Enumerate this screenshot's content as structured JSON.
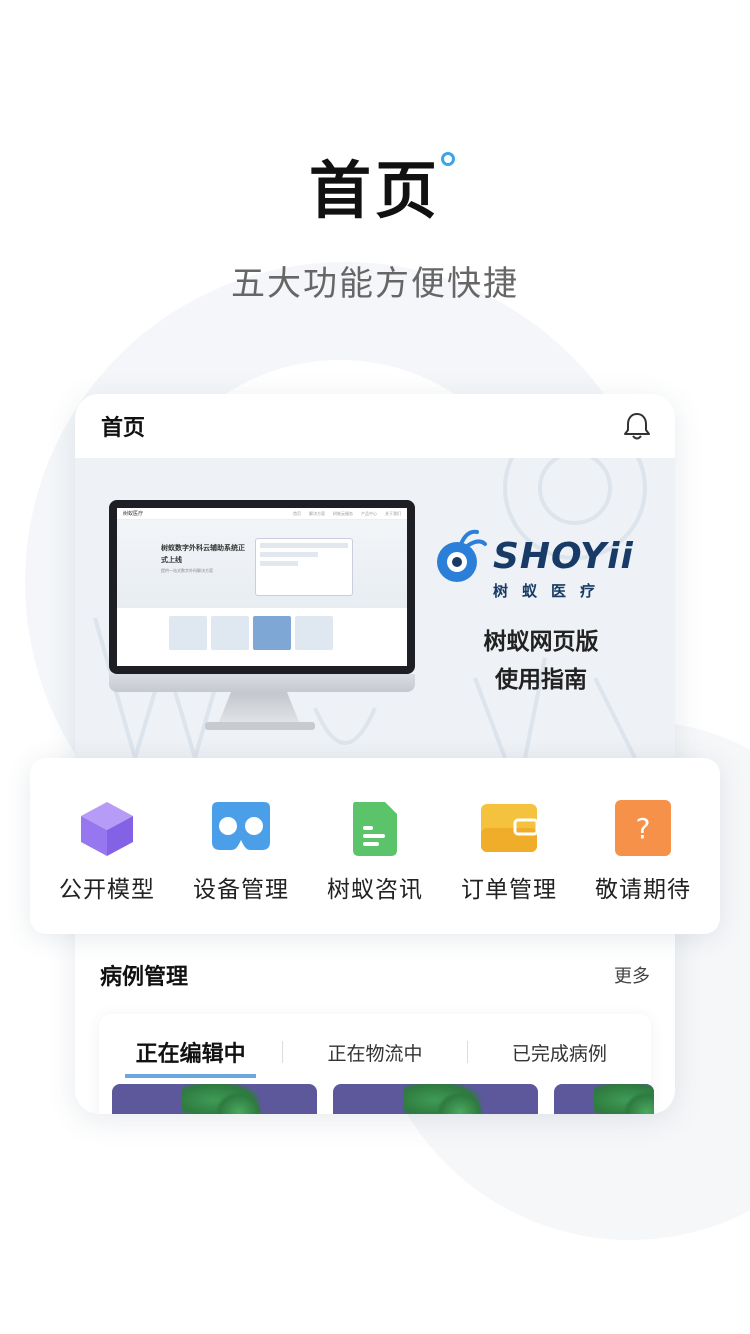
{
  "hero": {
    "title": "首页",
    "subtitle": "五大功能方便快捷"
  },
  "phone": {
    "header_title": "首页",
    "bell_icon": "bell-icon",
    "banner": {
      "screen_logo": "树蚁医疗",
      "screen_nav": [
        "首页",
        "解决方案",
        "树蚁云服务",
        "产品中心",
        "关于我们"
      ],
      "screen_title": "树蚁数字外科云辅助系统正式上线",
      "screen_sub": "提供一站式数字外科解决方案",
      "brand_word": "SHOYii",
      "brand_cn": "树蚁医疗",
      "tag_line1": "树蚁网页版",
      "tag_line2": "使用指南"
    }
  },
  "functions": [
    {
      "label": "公开模型",
      "icon": "cube-icon",
      "color": "#9b7cf2"
    },
    {
      "label": "设备管理",
      "icon": "vr-headset-icon",
      "color": "#4a9fe8"
    },
    {
      "label": "树蚁咨讯",
      "icon": "document-icon",
      "color": "#5bc46a"
    },
    {
      "label": "订单管理",
      "icon": "wallet-icon",
      "color": "#f2b52c"
    },
    {
      "label": "敬请期待",
      "icon": "question-icon",
      "color": "#f6914a"
    }
  ],
  "cases": {
    "title": "病例管理",
    "more": "更多",
    "tabs": [
      "正在编辑中",
      "正在物流中",
      "已完成病例"
    ]
  },
  "colors": {
    "accent_blue": "#3c8ad6",
    "thumb_bg": "#5d579b"
  }
}
